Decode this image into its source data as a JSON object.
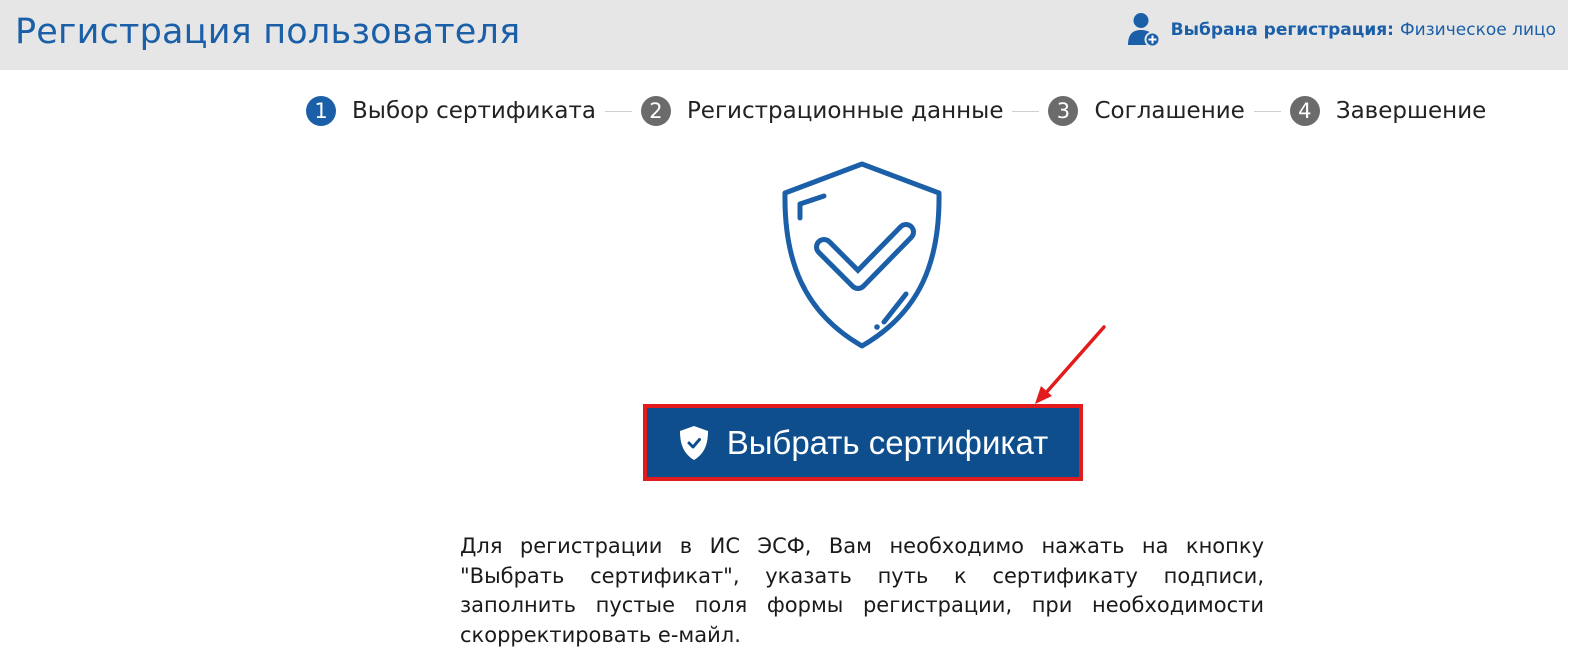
{
  "header": {
    "title": "Регистрация пользователя",
    "registration_label": "Выбрана регистрация:",
    "registration_value": "Физическое лицо"
  },
  "steps": [
    {
      "number": "1",
      "label": "Выбор сертификата",
      "active": true
    },
    {
      "number": "2",
      "label": "Регистрационные данные",
      "active": false
    },
    {
      "number": "3",
      "label": "Соглашение",
      "active": false
    },
    {
      "number": "4",
      "label": "Завершение",
      "active": false
    }
  ],
  "main": {
    "select_certificate_label": "Выбрать сертификат",
    "description": "Для регистрации в ИС ЭСФ, Вам необходимо нажать на кнопку \"Выбрать сертификат\", указать путь к сертификату подписи, заполнить пустые поля формы регистрации, при необходимости скорректировать е-майл."
  },
  "colors": {
    "brand_blue": "#1a5fa8",
    "button_blue": "#0f4e8c",
    "highlight_red": "#e21c1c",
    "inactive_step": "#6b6b6b"
  },
  "icons": {
    "user": "user-add-icon",
    "shield": "shield-check-icon",
    "arrow": "red-arrow-annotation"
  }
}
